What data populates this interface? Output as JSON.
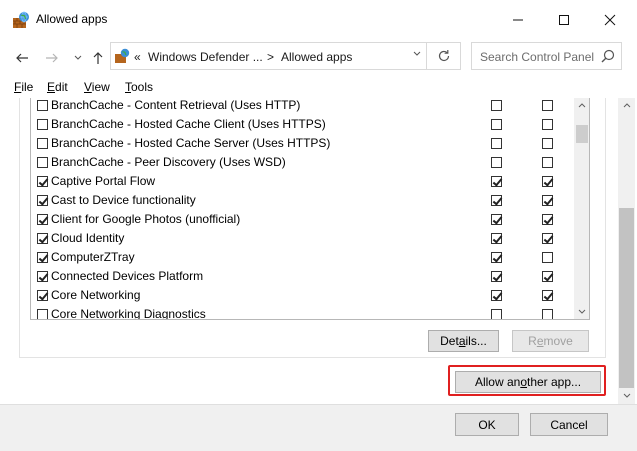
{
  "window": {
    "title": "Allowed apps"
  },
  "nav": {
    "breadcrumb_prefix": "«",
    "breadcrumb_1": "Windows Defender ...",
    "breadcrumb_sep": ">",
    "breadcrumb_2": "Allowed apps",
    "search_placeholder": "Search Control Panel"
  },
  "menu": {
    "file": "File",
    "edit": "Edit",
    "view": "View",
    "tools": "Tools"
  },
  "apps": [
    {
      "name": "BranchCache - Content Retrieval (Uses HTTP)",
      "enabled": false,
      "private": false,
      "public": false
    },
    {
      "name": "BranchCache - Hosted Cache Client (Uses HTTPS)",
      "enabled": false,
      "private": false,
      "public": false
    },
    {
      "name": "BranchCache - Hosted Cache Server (Uses HTTPS)",
      "enabled": false,
      "private": false,
      "public": false
    },
    {
      "name": "BranchCache - Peer Discovery (Uses WSD)",
      "enabled": false,
      "private": false,
      "public": false
    },
    {
      "name": "Captive Portal Flow",
      "enabled": true,
      "private": true,
      "public": true
    },
    {
      "name": "Cast to Device functionality",
      "enabled": true,
      "private": true,
      "public": true
    },
    {
      "name": "Client for Google Photos (unofficial)",
      "enabled": true,
      "private": true,
      "public": true
    },
    {
      "name": "Cloud Identity",
      "enabled": true,
      "private": true,
      "public": true
    },
    {
      "name": "ComputerZTray",
      "enabled": true,
      "private": true,
      "public": false
    },
    {
      "name": "Connected Devices Platform",
      "enabled": true,
      "private": true,
      "public": true
    },
    {
      "name": "Core Networking",
      "enabled": true,
      "private": true,
      "public": true
    },
    {
      "name": "Core Networking Diagnostics",
      "enabled": false,
      "private": false,
      "public": false
    }
  ],
  "buttons": {
    "details": "Details...",
    "remove": "Remove",
    "allow_another": "Allow another app...",
    "ok": "OK",
    "cancel": "Cancel"
  },
  "colors": {
    "highlight": "#e02020"
  }
}
